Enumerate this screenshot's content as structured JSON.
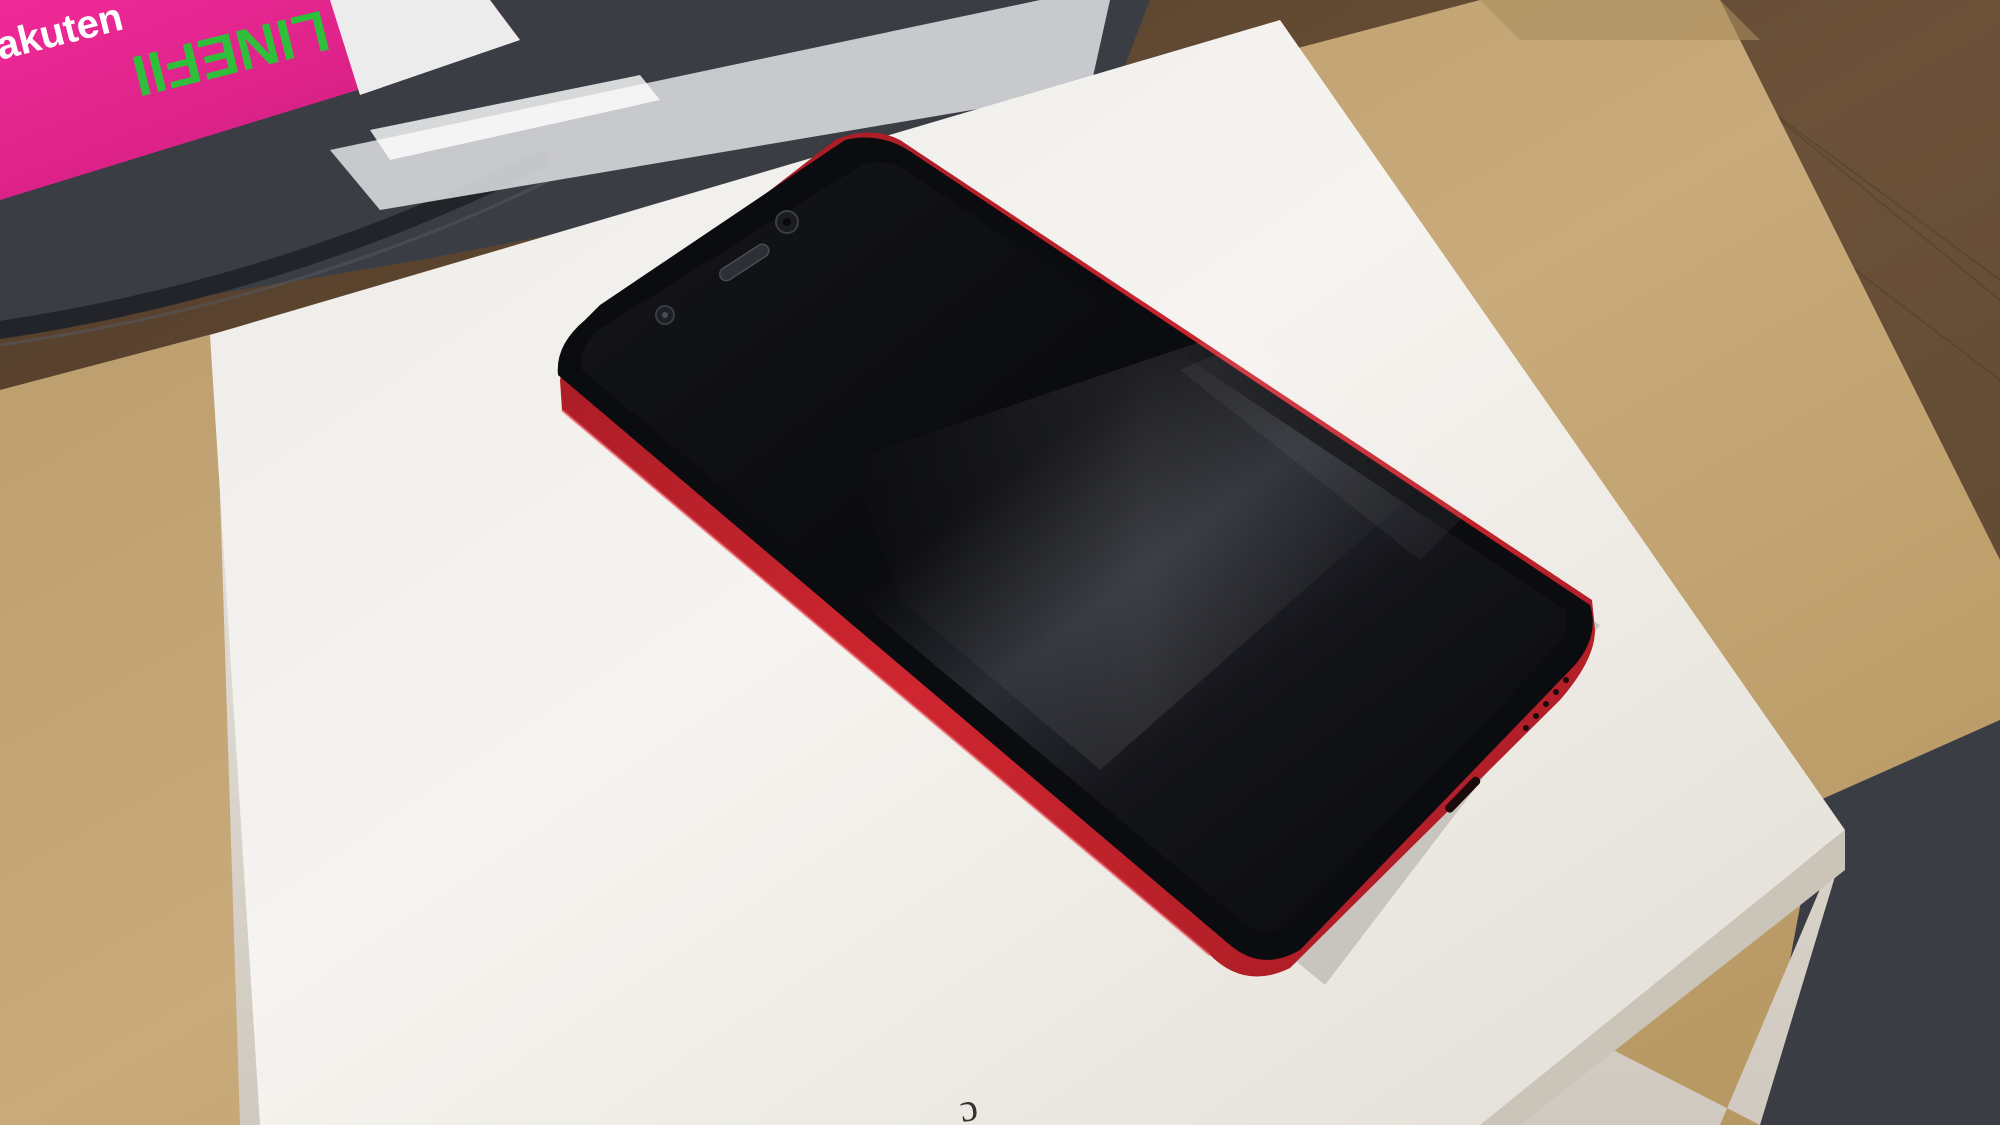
{
  "scene": {
    "description_visible_text": {
      "flyer_brand": "akuten",
      "flyer_logo": "LINEFII"
    },
    "colors": {
      "table": "#6b5138",
      "cardboard": "#c4a676",
      "cardboard_shadow": "#a98c5e",
      "box_top": "#f4f1ec",
      "box_side": "#dcd6cd",
      "phone_frame": "#c8222a",
      "phone_glass": "#0c0d10",
      "flyer_pink": "#e2238c",
      "flyer_green": "#2fbf3a",
      "sleeve": "#3b3d45"
    }
  }
}
